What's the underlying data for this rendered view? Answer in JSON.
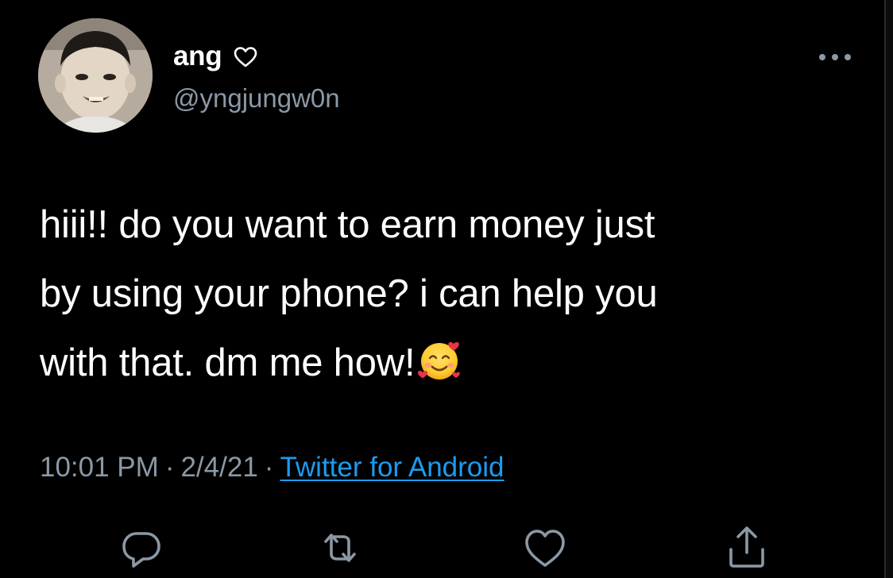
{
  "user": {
    "display_name": "ang",
    "name_icon": "heart-outline-icon",
    "handle": "@yngjungw0n",
    "avatar": "avatar"
  },
  "tweet": {
    "lines": [
      "hiii!! do you want to earn money just",
      "by using your phone? i can help you",
      "with that. dm me how!"
    ],
    "emoji": "smiling-face-with-hearts-emoji"
  },
  "meta": {
    "time": "10:01 PM",
    "separator": "·",
    "date": "2/4/21",
    "source": "Twitter for Android"
  },
  "actions": [
    {
      "name": "reply",
      "icon": "reply-icon"
    },
    {
      "name": "retweet",
      "icon": "retweet-icon"
    },
    {
      "name": "like",
      "icon": "heart-icon"
    },
    {
      "name": "share",
      "icon": "share-icon"
    }
  ],
  "colors": {
    "background": "#000000",
    "text": "#ffffff",
    "secondary": "#8b98a5",
    "link": "#1d9bf0"
  }
}
